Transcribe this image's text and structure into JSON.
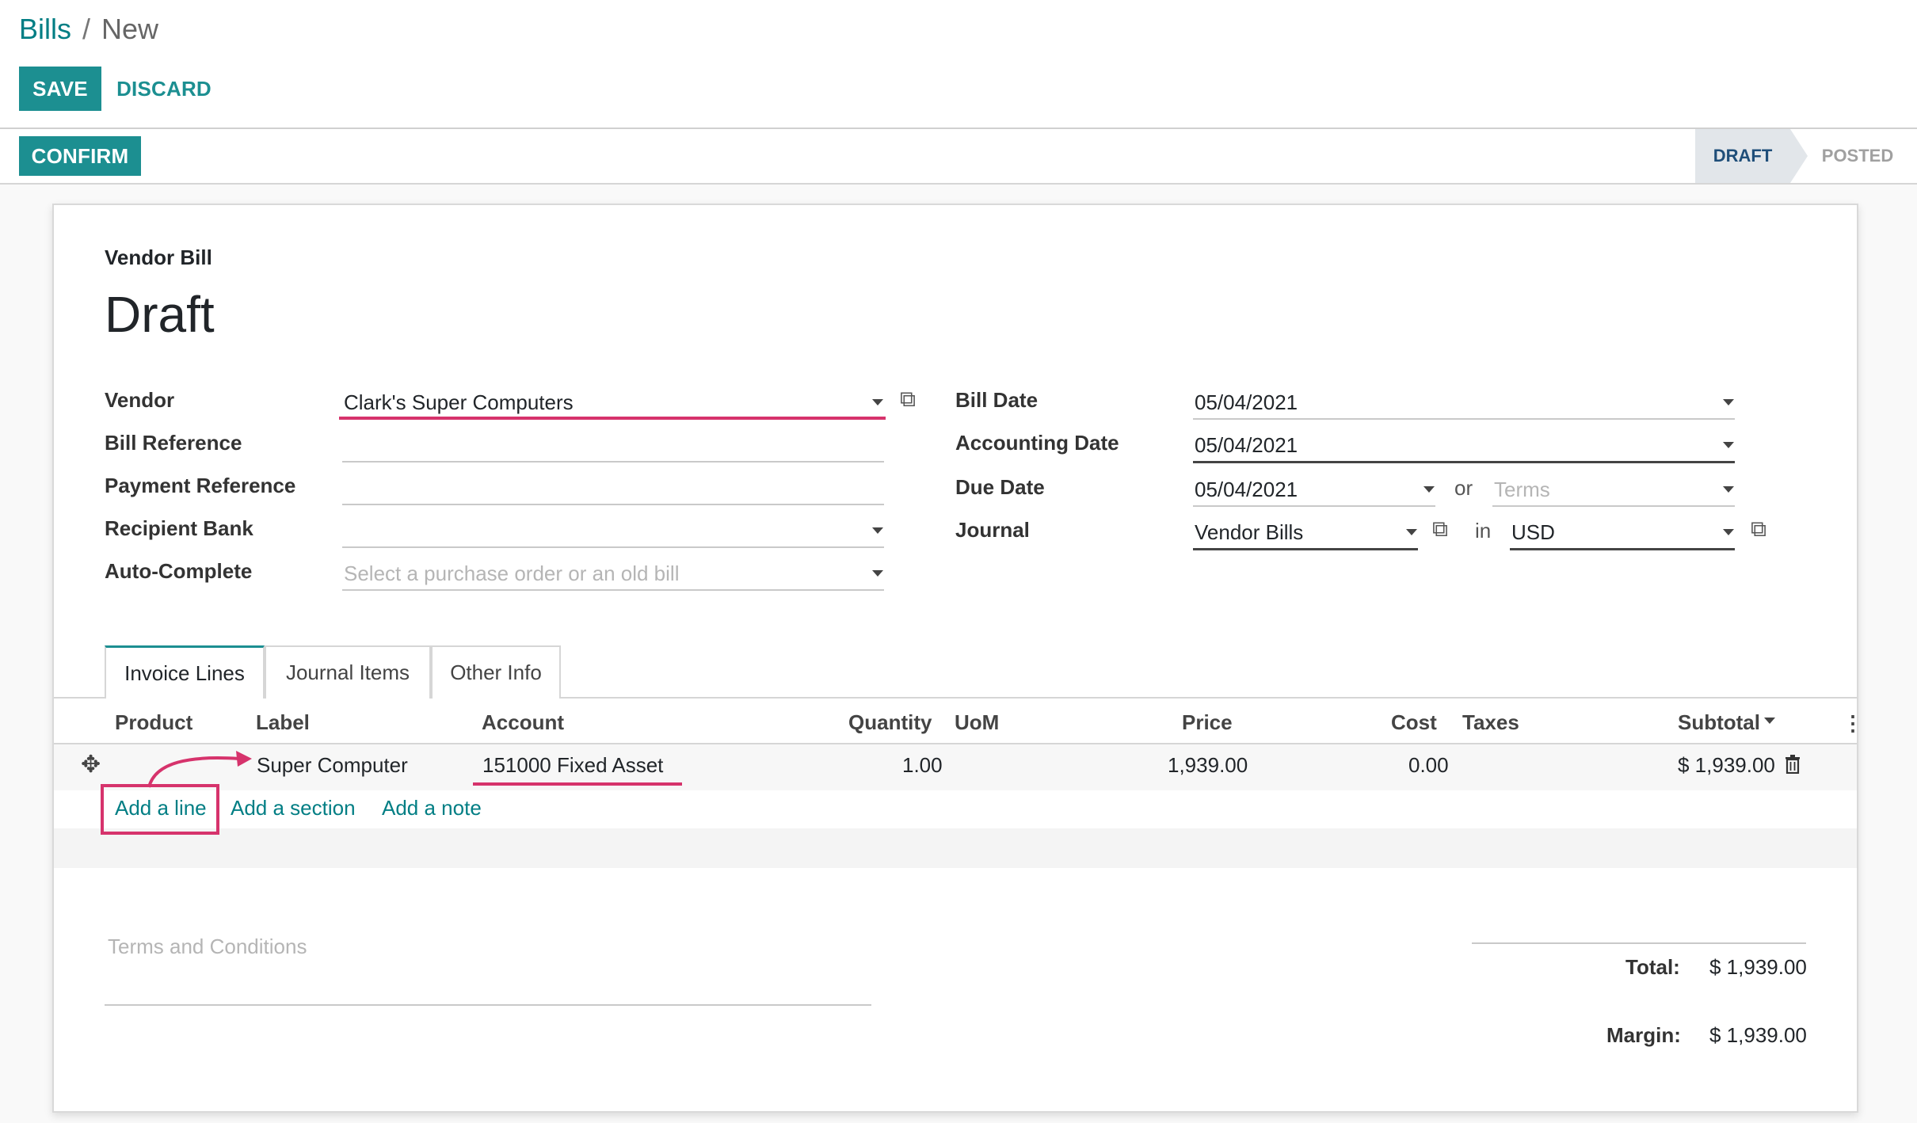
{
  "breadcrumb": {
    "parent": "Bills",
    "separator": "/",
    "current": "New"
  },
  "toolbar": {
    "save_label": "SAVE",
    "discard_label": "DISCARD",
    "confirm_label": "CONFIRM"
  },
  "status": {
    "stages": [
      "DRAFT",
      "POSTED"
    ],
    "active": "DRAFT"
  },
  "form": {
    "type_label": "Vendor Bill",
    "name": "Draft",
    "left_fields": [
      {
        "label": "Vendor",
        "value": "Clark's Super Computers"
      },
      {
        "label": "Bill Reference",
        "value": ""
      },
      {
        "label": "Payment Reference",
        "value": ""
      },
      {
        "label": "Recipient Bank",
        "value": ""
      },
      {
        "label": "Auto-Complete",
        "placeholder": "Select a purchase order or an old bill"
      }
    ],
    "right_fields": [
      {
        "label": "Bill Date",
        "value": "05/04/2021"
      },
      {
        "label": "Accounting Date",
        "value": "05/04/2021"
      },
      {
        "label": "Due Date",
        "value": "05/04/2021",
        "or_text": "or",
        "terms_placeholder": "Terms"
      },
      {
        "label": "Journal",
        "value": "Vendor Bills",
        "in_text": "in",
        "currency": "USD"
      }
    ]
  },
  "tabs": [
    {
      "label": "Invoice Lines",
      "active": true
    },
    {
      "label": "Journal Items",
      "active": false
    },
    {
      "label": "Other Info",
      "active": false
    }
  ],
  "lines_table": {
    "columns": [
      "Product",
      "Label",
      "Account",
      "Quantity",
      "UoM",
      "Price",
      "Cost",
      "Taxes",
      "Subtotal"
    ],
    "rows": [
      {
        "product": "",
        "label": "Super Computer",
        "account": "151000 Fixed Asset",
        "quantity": "1.00",
        "uom": "",
        "price": "1,939.00",
        "cost": "0.00",
        "taxes": "",
        "subtotal": "$ 1,939.00"
      }
    ],
    "add_links": {
      "line": "Add a line",
      "section": "Add a section",
      "note": "Add a note"
    }
  },
  "footer": {
    "terms_placeholder": "Terms and Conditions",
    "total_label": "Total:",
    "total_value": "$ 1,939.00",
    "margin_label": "Margin:",
    "margin_value": "$ 1,939.00"
  },
  "colors": {
    "primary": "#1c8f91",
    "link": "#017e84",
    "highlight": "#d6336c"
  }
}
